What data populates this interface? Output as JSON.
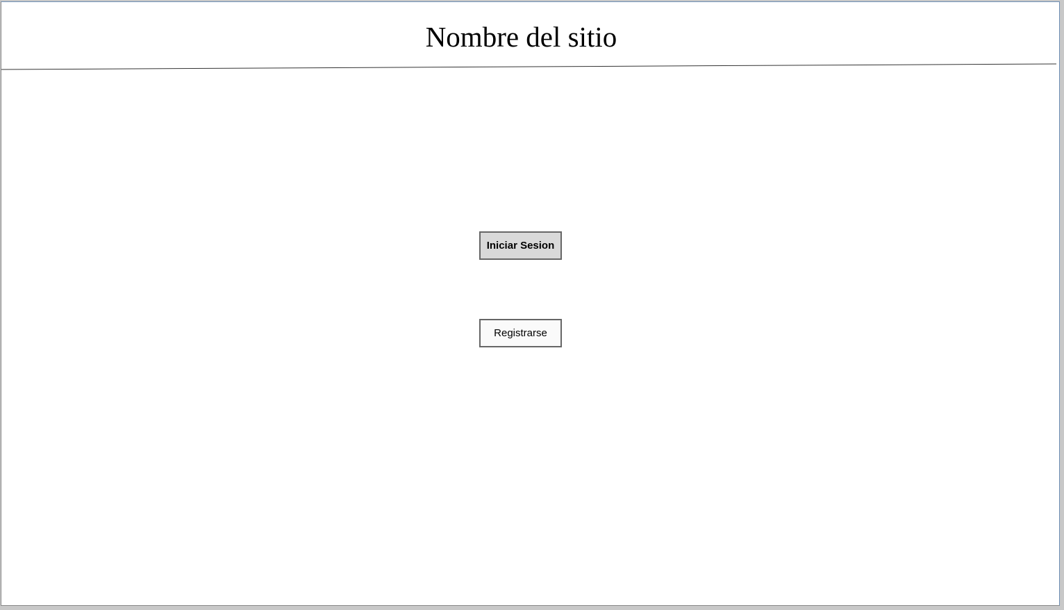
{
  "header": {
    "site_name": "Nombre del sitio"
  },
  "actions": {
    "login_label": "Iniciar Sesion",
    "register_label": "Registrarse"
  }
}
